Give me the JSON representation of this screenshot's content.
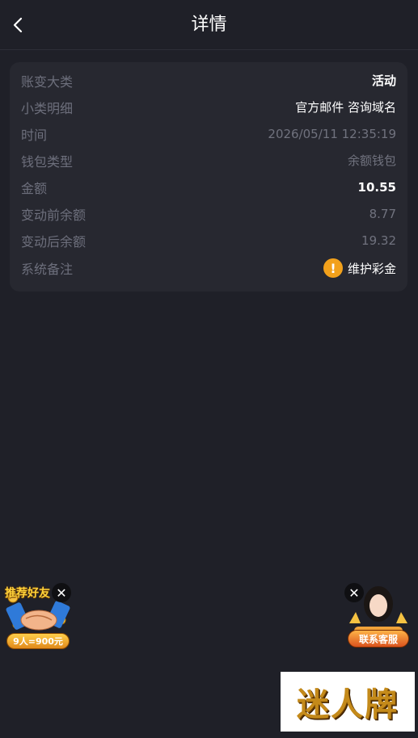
{
  "header": {
    "title": "详情"
  },
  "detail": {
    "rows": [
      {
        "label": "账变大类",
        "value": "活动"
      },
      {
        "label": "小类明细",
        "value": "官方邮件 咨询域名"
      },
      {
        "label": "时间",
        "value": "2026/05/11 12:35:19"
      },
      {
        "label": "钱包类型",
        "value": "余额钱包"
      },
      {
        "label": "金额",
        "value": "10.55"
      },
      {
        "label": "变动前余额",
        "value": "8.77"
      },
      {
        "label": "变动后余额",
        "value": "19.32"
      },
      {
        "label": "系统备注",
        "value": "维护彩金"
      }
    ]
  },
  "floats": {
    "promo": {
      "title": "推荐好友",
      "reward": "9人=900元",
      "close": "✕"
    },
    "service": {
      "label": "联系客服",
      "close": "✕"
    }
  },
  "brand": {
    "text": "迷人牌"
  },
  "colors": {
    "background": "#1f2028",
    "card": "#272830",
    "warning": "#f2a11b"
  }
}
